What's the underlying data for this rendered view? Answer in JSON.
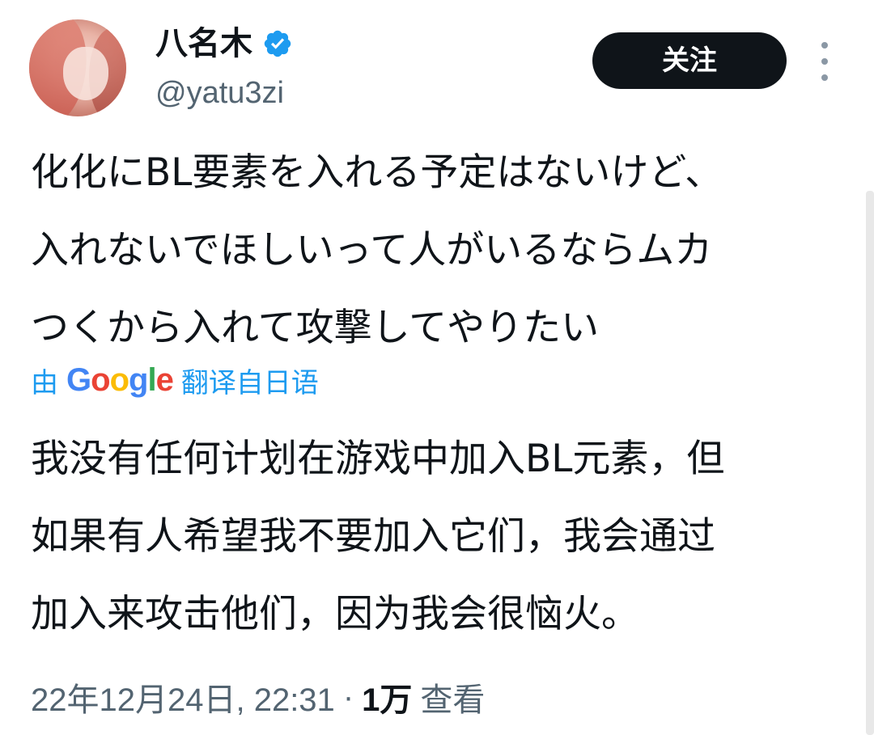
{
  "user": {
    "display_name": "八名木",
    "handle": "@yatu3zi",
    "verified_icon": "verified-badge-icon"
  },
  "actions": {
    "follow_label": "关注",
    "more_icon": "more-vertical-icon"
  },
  "tweet": {
    "original_text": "化化にBL要素を入れる予定はないけど、\n入れないでほしいって人がいるならムカ\nつくから入れて攻撃してやりたい",
    "translated_by_prefix": "由",
    "translated_by_brand": "Google",
    "translated_by_suffix": "翻译自日语",
    "translated_text": "我没有任何计划在游戏中加入BL元素，但\n如果有人希望我不要加入它们，我会通过\n加入来攻击他们，因为我会很恼火。",
    "timestamp": "22年12月24日, 22:31",
    "separator": "·",
    "views_count": "1万",
    "views_label": "查看"
  },
  "colors": {
    "accent": "#1d9bf0",
    "text_primary": "#0f1419",
    "text_secondary": "#536471",
    "button_bg": "#0f1419"
  }
}
